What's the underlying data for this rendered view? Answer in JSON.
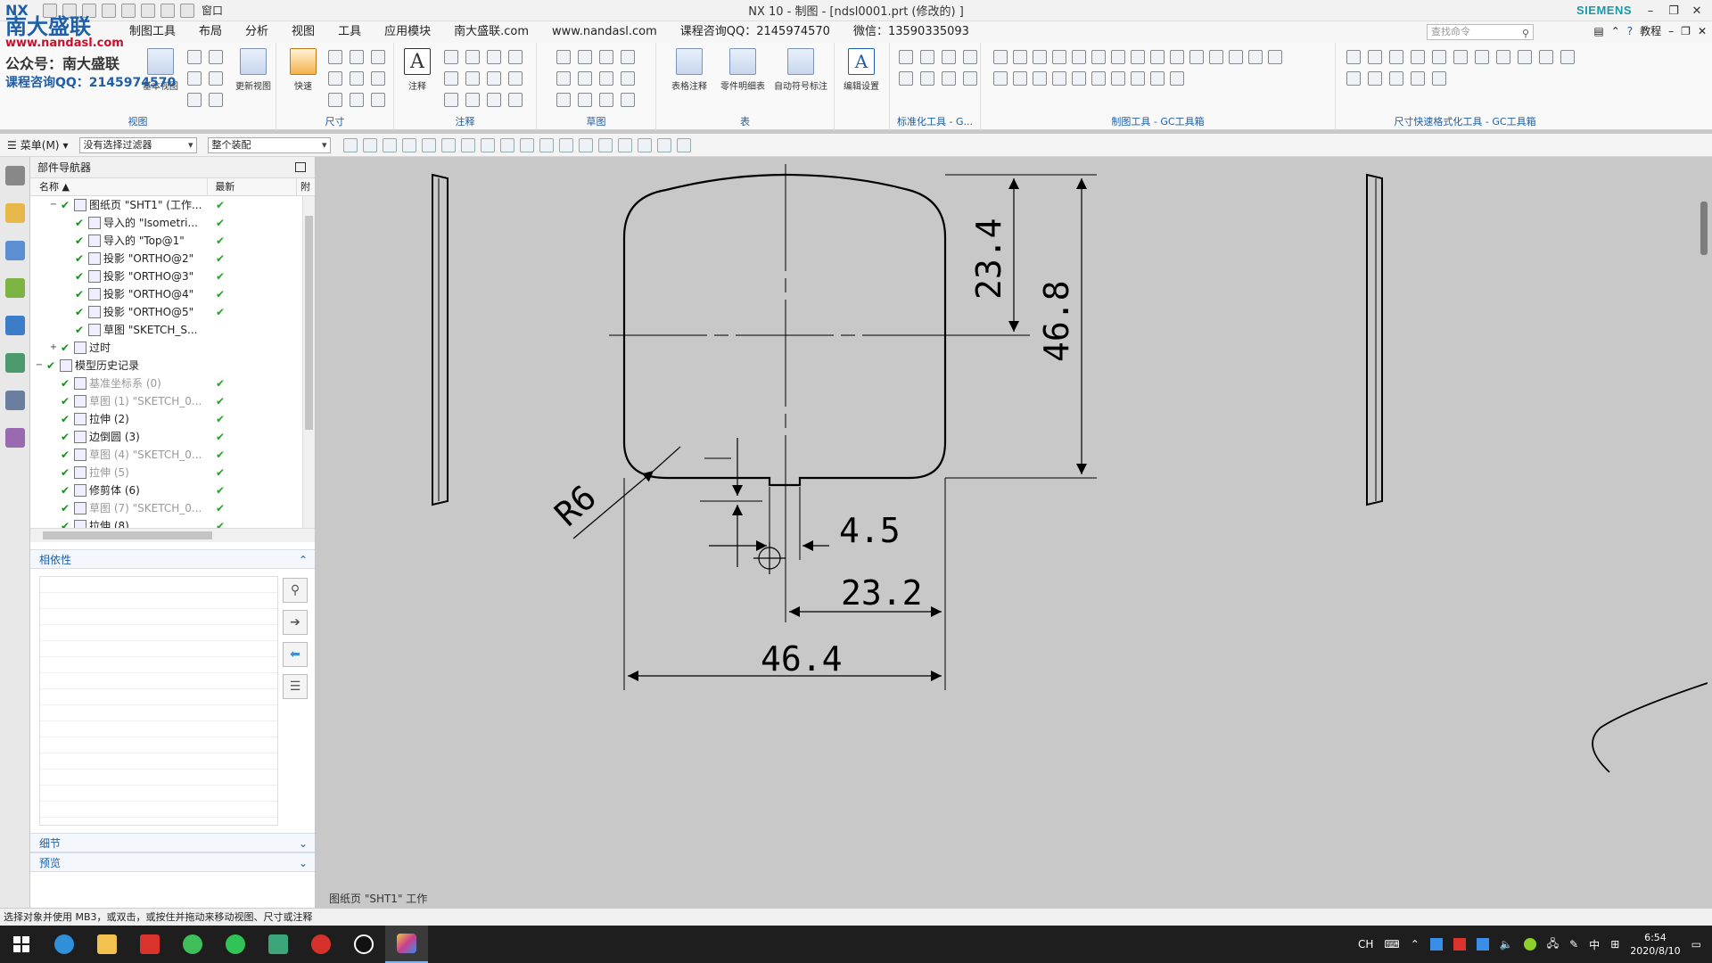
{
  "titlebar": {
    "app_logo": "NX",
    "window_menu": "窗口",
    "title": "NX 10 - 制图 - [ndsl0001.prt  (修改的) ]",
    "brand": "SIEMENS"
  },
  "watermark": {
    "title": "南大盛联",
    "url": "www.nandasl.com",
    "line1": "公众号：南大盛联",
    "line2": "课程咨询QQ：2145974570"
  },
  "menubar": {
    "items": [
      "制图工具",
      "布局",
      "分析",
      "视图",
      "工具",
      "应用模块",
      "南大盛联.com",
      "www.nandasl.com",
      "课程咨询QQ：2145974570",
      "微信：13590335093"
    ],
    "search_placeholder": "查找命令",
    "help_label": "教程"
  },
  "ribbon": {
    "groups": [
      {
        "label": "视图",
        "buttons": [
          "基本视图",
          "更新视图"
        ]
      },
      {
        "label": "尺寸",
        "buttons": [
          "快速"
        ]
      },
      {
        "label": "注释",
        "buttons": [
          "注释"
        ]
      },
      {
        "label": "草图",
        "buttons": []
      },
      {
        "label": "表",
        "buttons": [
          "表格注释",
          "零件明细表",
          "自动符号标注"
        ]
      },
      {
        "label": "",
        "buttons": [
          "编辑设置"
        ]
      },
      {
        "label": "标准化工具 - G...",
        "buttons": []
      },
      {
        "label": "制图工具 - GC工具箱",
        "buttons": []
      },
      {
        "label": "尺寸快速格式化工具 - GC工具箱",
        "buttons": []
      }
    ]
  },
  "selbar": {
    "menu_label": "菜单(M)",
    "filter": "没有选择过滤器",
    "scope": "整个装配"
  },
  "navigator": {
    "title": "部件导航器",
    "col_name": "名称",
    "col_latest": "最新",
    "col_extra": "附",
    "rows": [
      {
        "indent": 1,
        "expander": "−",
        "label": "图纸页 \"SHT1\" (工作...",
        "latest": "✔",
        "dim": false
      },
      {
        "indent": 2,
        "expander": "",
        "label": "导入的 \"Isometri...",
        "latest": "✔",
        "dim": false
      },
      {
        "indent": 2,
        "expander": "",
        "label": "导入的 \"Top@1\"",
        "latest": "✔",
        "dim": false
      },
      {
        "indent": 2,
        "expander": "",
        "label": "投影 \"ORTHO@2\"",
        "latest": "✔",
        "dim": false
      },
      {
        "indent": 2,
        "expander": "",
        "label": "投影 \"ORTHO@3\"",
        "latest": "✔",
        "dim": false
      },
      {
        "indent": 2,
        "expander": "",
        "label": "投影 \"ORTHO@4\"",
        "latest": "✔",
        "dim": false
      },
      {
        "indent": 2,
        "expander": "",
        "label": "投影 \"ORTHO@5\"",
        "latest": "✔",
        "dim": false
      },
      {
        "indent": 2,
        "expander": "",
        "label": "草图 \"SKETCH_S...",
        "latest": "",
        "dim": false
      },
      {
        "indent": 1,
        "expander": "+",
        "label": "过时",
        "latest": "",
        "dim": false
      },
      {
        "indent": 0,
        "expander": "−",
        "label": "模型历史记录",
        "latest": "",
        "dim": false
      },
      {
        "indent": 1,
        "expander": "",
        "label": "基准坐标系 (0)",
        "latest": "✔",
        "dim": true
      },
      {
        "indent": 1,
        "expander": "",
        "label": "草图 (1) \"SKETCH_0...",
        "latest": "✔",
        "dim": true
      },
      {
        "indent": 1,
        "expander": "",
        "label": "拉伸 (2)",
        "latest": "✔",
        "dim": false
      },
      {
        "indent": 1,
        "expander": "",
        "label": "边倒圆 (3)",
        "latest": "✔",
        "dim": false
      },
      {
        "indent": 1,
        "expander": "",
        "label": "草图 (4) \"SKETCH_0...",
        "latest": "✔",
        "dim": true
      },
      {
        "indent": 1,
        "expander": "",
        "label": "拉伸 (5)",
        "latest": "✔",
        "dim": true
      },
      {
        "indent": 1,
        "expander": "",
        "label": "修剪体 (6)",
        "latest": "✔",
        "dim": false
      },
      {
        "indent": 1,
        "expander": "",
        "label": "草图 (7) \"SKETCH_0...",
        "latest": "✔",
        "dim": true
      },
      {
        "indent": 1,
        "expander": "",
        "label": "拉伸 (8)",
        "latest": "✔",
        "dim": false
      }
    ],
    "dependency_title": "相依性",
    "details_title": "细节",
    "preview_title": "预览"
  },
  "drawing": {
    "dims": {
      "d_23_4": "23.4",
      "d_46_8": "46.8",
      "d_r6": "R6",
      "d_4_5": "4.5",
      "d_23_2": "23.2",
      "d_46_4": "46.4"
    },
    "sheet_label": "图纸页 \"SHT1\" 工作"
  },
  "status": {
    "text": "选择对象并使用 MB3，或双击，或按住并拖动来移动视图、尺寸或注释"
  },
  "taskbar": {
    "ime": "中",
    "time": "6:54",
    "date": "2020/8/10"
  }
}
